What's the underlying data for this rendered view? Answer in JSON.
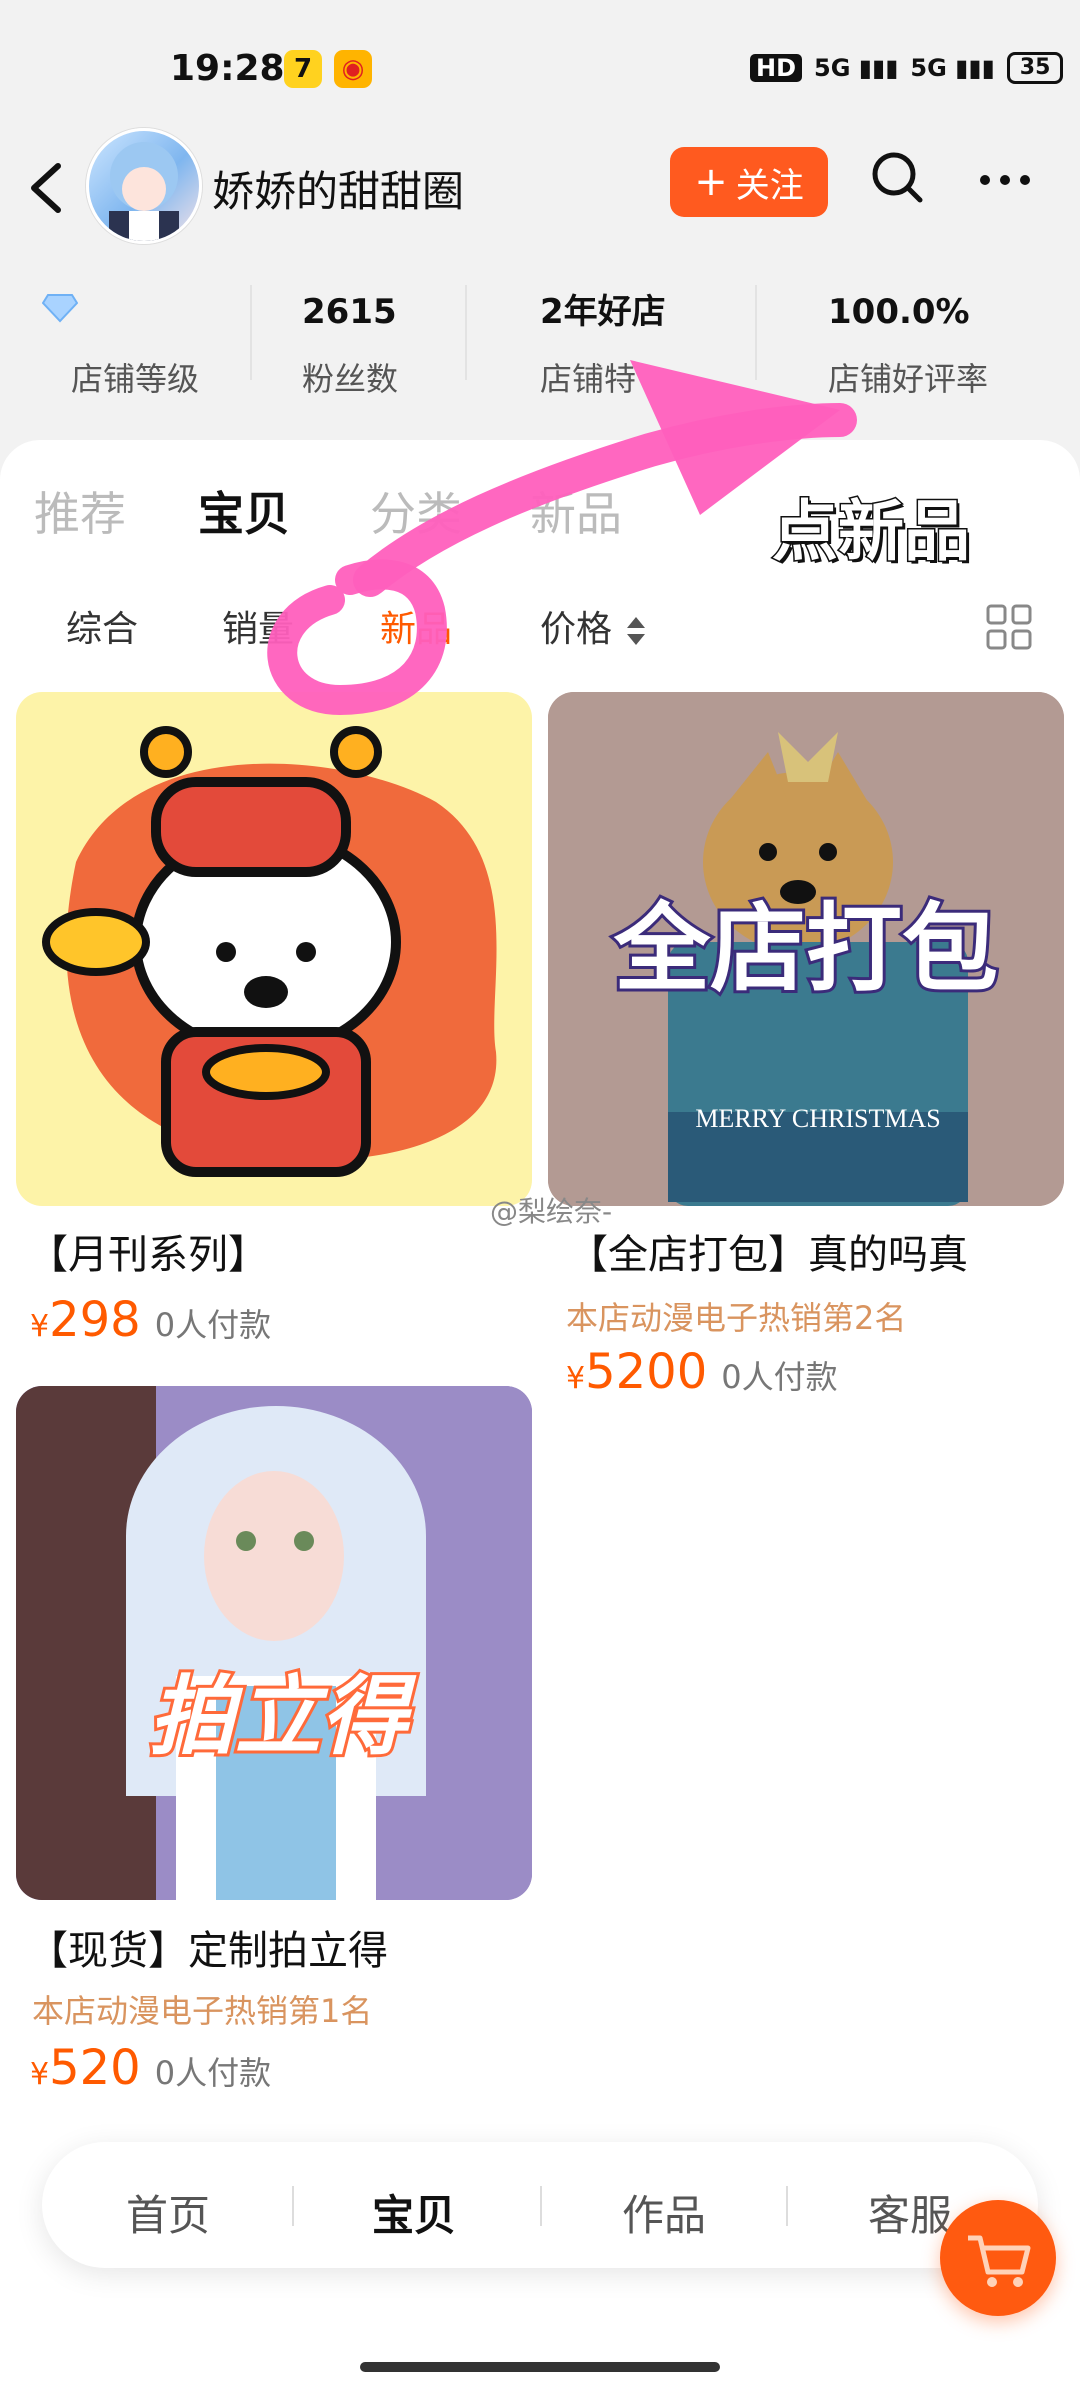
{
  "status_bar": {
    "time": "19:28",
    "battery": "35",
    "network1": "5G",
    "network2": "5G",
    "hd": "HD"
  },
  "header": {
    "shop_name": "娇娇的甜甜圈",
    "follow_label": "关注"
  },
  "stats": [
    {
      "value": "",
      "label": "店铺等级"
    },
    {
      "value": "2615",
      "label": "粉丝数"
    },
    {
      "value": "2年好店",
      "label": "店铺特"
    },
    {
      "value": "100.0%",
      "label": "店铺好评率"
    }
  ],
  "top_tabs": [
    "推荐",
    "宝贝",
    "分类",
    "新品"
  ],
  "filters": [
    "综合",
    "销量",
    "新品",
    "价格"
  ],
  "annotation": "点新品",
  "watermark": "@梨绘奈-",
  "products": [
    {
      "title": "【月刊系列】",
      "rank": "",
      "price": "298",
      "currency": "¥",
      "sold": "0人付款"
    },
    {
      "title": "【全店打包】真的吗真",
      "rank": "本店动漫电子热销第2名",
      "price": "5200",
      "currency": "¥",
      "sold": "0人付款",
      "overlay": "全店打包",
      "wrap_text": "MERRY CHRISTMAS"
    },
    {
      "title": "【现货】定制拍立得",
      "rank": "本店动漫电子热销第1名",
      "price": "520",
      "currency": "¥",
      "sold": "0人付款",
      "overlay": "拍立得"
    }
  ],
  "bottom_nav": [
    "首页",
    "宝贝",
    "作品",
    "客服"
  ],
  "colors": {
    "accent": "#ff5a00",
    "follow": "#ff5a1f",
    "rank": "#d9945f",
    "annotation_pink": "#ff5fbd"
  }
}
